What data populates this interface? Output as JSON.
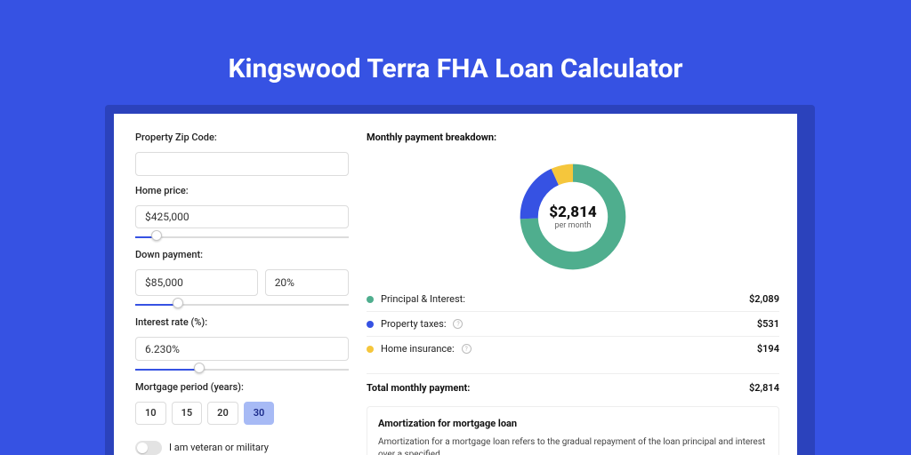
{
  "colors": {
    "green": "#4fae8e",
    "blue": "#3652e3",
    "yellow": "#f5c63c"
  },
  "title": "Kingswood Terra FHA Loan Calculator",
  "form": {
    "zip_label": "Property Zip Code:",
    "zip_value": "",
    "home_price_label": "Home price:",
    "home_price_value": "$425,000",
    "home_price_slider_pct": 10,
    "down_label": "Down payment:",
    "down_value": "$85,000",
    "down_pct_value": "20%",
    "down_slider_pct": 20,
    "rate_label": "Interest rate (%):",
    "rate_value": "6.230%",
    "rate_slider_pct": 30,
    "term_label": "Mortgage period (years):",
    "terms": [
      "10",
      "15",
      "20",
      "30"
    ],
    "term_selected": "30",
    "veteran_label": "I am veteran or military",
    "veteran_on": false
  },
  "breakdown": {
    "title": "Monthly payment breakdown:",
    "center_amount": "$2,814",
    "center_sub": "per month",
    "items": [
      {
        "label": "Principal & Interest:",
        "value": "$2,089",
        "colorKey": "green",
        "info": false
      },
      {
        "label": "Property taxes:",
        "value": "$531",
        "colorKey": "blue",
        "info": true
      },
      {
        "label": "Home insurance:",
        "value": "$194",
        "colorKey": "yellow",
        "info": true
      }
    ],
    "total_label": "Total monthly payment:",
    "total_value": "$2,814"
  },
  "amort": {
    "title": "Amortization for mortgage loan",
    "text": "Amortization for a mortgage loan refers to the gradual repayment of the loan principal and interest over a specified"
  },
  "chart_data": {
    "type": "pie",
    "title": "Monthly payment breakdown",
    "series": [
      {
        "name": "Principal & Interest",
        "value": 2089,
        "color": "#4fae8e"
      },
      {
        "name": "Property taxes",
        "value": 531,
        "color": "#3652e3"
      },
      {
        "name": "Home insurance",
        "value": 194,
        "color": "#f5c63c"
      }
    ],
    "total": 2814,
    "center_label": "$2,814 per month"
  }
}
